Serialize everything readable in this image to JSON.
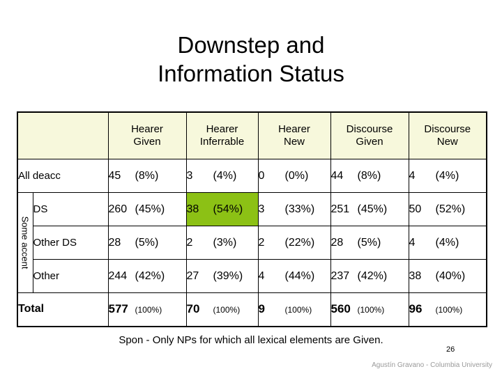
{
  "slide": {
    "title_line1": "Downstep and",
    "title_line2": "Information Status",
    "footer_note": "Spon - Only NPs for which all lexical elements are Given.",
    "page_number": "26",
    "attribution": "Agustín Gravano - Columbia University",
    "highlight_color": "#8CC115",
    "header_background": "#F7F8DC"
  },
  "table": {
    "corner_label": "",
    "group_label": "Some accent",
    "headers": [
      {
        "line1": "Hearer",
        "line2": "Given"
      },
      {
        "line1": "Hearer",
        "line2": "Inferrable"
      },
      {
        "line1": "Hearer",
        "line2": "New"
      },
      {
        "line1": "Discourse",
        "line2": "Given"
      },
      {
        "line1": "Discourse",
        "line2": "New"
      }
    ],
    "rows": [
      {
        "label": "All deacc",
        "cells": [
          {
            "count": "45",
            "pct": "(8%)",
            "highlight": false
          },
          {
            "count": "3",
            "pct": "(4%)",
            "highlight": false
          },
          {
            "count": "0",
            "pct": "(0%)",
            "highlight": false
          },
          {
            "count": "44",
            "pct": "(8%)",
            "highlight": false
          },
          {
            "count": "4",
            "pct": "(4%)",
            "highlight": false
          }
        ]
      },
      {
        "label": "DS",
        "cells": [
          {
            "count": "260",
            "pct": "(45%)",
            "highlight": false
          },
          {
            "count": "38",
            "pct": "(54%)",
            "highlight": true
          },
          {
            "count": "3",
            "pct": "(33%)",
            "highlight": false
          },
          {
            "count": "251",
            "pct": "(45%)",
            "highlight": false
          },
          {
            "count": "50",
            "pct": "(52%)",
            "highlight": false
          }
        ]
      },
      {
        "label": "Other DS",
        "cells": [
          {
            "count": "28",
            "pct": "(5%)",
            "highlight": false
          },
          {
            "count": "2",
            "pct": "(3%)",
            "highlight": false
          },
          {
            "count": "2",
            "pct": "(22%)",
            "highlight": false
          },
          {
            "count": "28",
            "pct": "(5%)",
            "highlight": false
          },
          {
            "count": "4",
            "pct": "(4%)",
            "highlight": false
          }
        ]
      },
      {
        "label": "Other",
        "cells": [
          {
            "count": "244",
            "pct": "(42%)",
            "highlight": false
          },
          {
            "count": "27",
            "pct": "(39%)",
            "highlight": false
          },
          {
            "count": "4",
            "pct": "(44%)",
            "highlight": false
          },
          {
            "count": "237",
            "pct": "(42%)",
            "highlight": false
          },
          {
            "count": "38",
            "pct": "(40%)",
            "highlight": false
          }
        ]
      },
      {
        "label": "Total",
        "total": true,
        "cells": [
          {
            "count": "577",
            "pct": "(100%)",
            "highlight": false
          },
          {
            "count": "70",
            "pct": "(100%)",
            "highlight": false
          },
          {
            "count": "9",
            "pct": "(100%)",
            "highlight": false
          },
          {
            "count": "560",
            "pct": "(100%)",
            "highlight": false
          },
          {
            "count": "96",
            "pct": "(100%)",
            "highlight": false
          }
        ]
      }
    ]
  }
}
